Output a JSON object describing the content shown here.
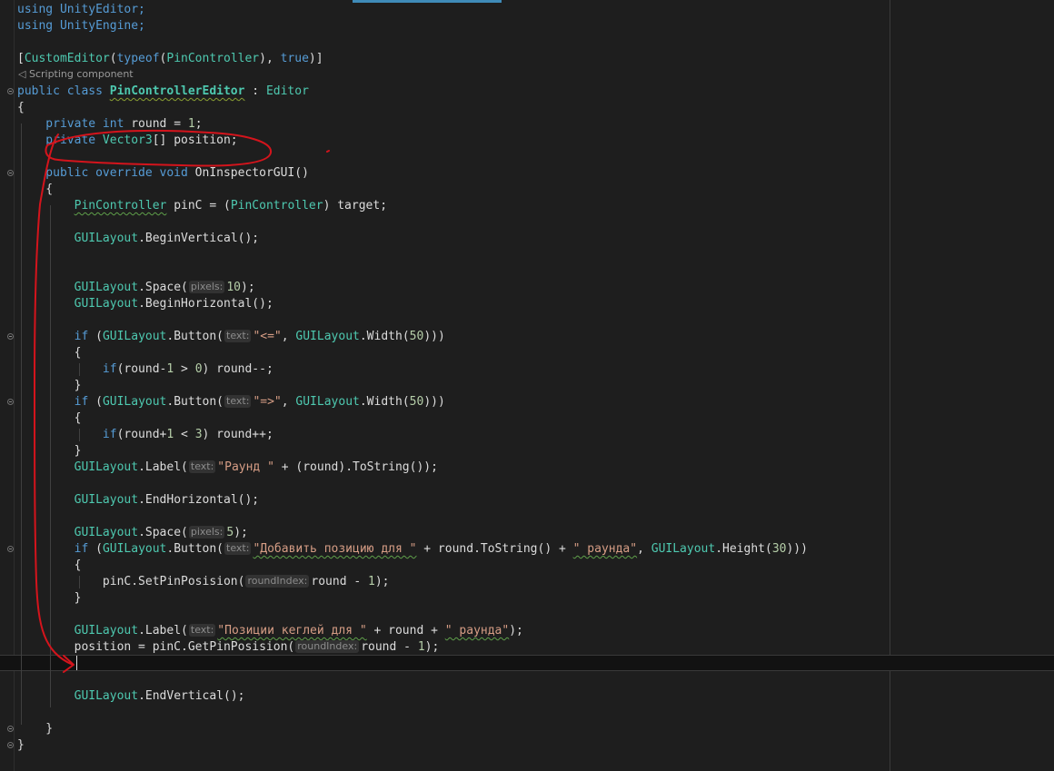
{
  "editor": {
    "codelens": "Scripting component",
    "hints": {
      "pixels": "pixels:",
      "text": "text:",
      "roundIndex": "roundIndex:"
    },
    "lines": {
      "l1": "using UnityEditor;",
      "l2": "using UnityEngine;",
      "l3a": "[",
      "l3b": "CustomEditor",
      "l3c": "(",
      "l3d": "typeof",
      "l3e": "(",
      "l3f": "PinController",
      "l3g": "), ",
      "l3h": "true",
      "l3i": ")]",
      "l4a": "public class ",
      "l4b": "PinControllerEditor",
      "l4c": " : ",
      "l4d": "Editor",
      "l5": "{",
      "l6a": "    private int ",
      "l6b": "round = ",
      "l6c": "1",
      "l6d": ";",
      "l7a": "    private ",
      "l7b": "Vector3",
      "l7c": "[] position;",
      "l8a": "    public override void ",
      "l8b": "OnInspectorGUI()",
      "l9": "    {",
      "l10a": "        ",
      "l10b": "PinController",
      "l10c": " pinC = (",
      "l10d": "PinController",
      "l10e": ") target;",
      "l11a": "        ",
      "l11b": "GUILayout",
      "l11c": ".BeginVertical();",
      "l12a": "        ",
      "l12b": "GUILayout",
      "l12c": ".Space(",
      "l12d": "10",
      "l12e": ");",
      "l13a": "        ",
      "l13b": "GUILayout",
      "l13c": ".BeginHorizontal();",
      "l14a": "        ",
      "l14b": "if",
      "l14c": " (",
      "l14d": "GUILayout",
      "l14e": ".Button(",
      "l14f": "\"<=\"",
      "l14g": ", ",
      "l14h": "GUILayout",
      "l14i": ".Width(",
      "l14j": "50",
      "l14k": ")))",
      "l15": "        {",
      "l16a": "            ",
      "l16b": "if",
      "l16c": "(round-",
      "l16d": "1",
      "l16e": " > ",
      "l16f": "0",
      "l16g": ") round--;",
      "l17": "        }",
      "l18a": "        ",
      "l18b": "if",
      "l18c": " (",
      "l18d": "GUILayout",
      "l18e": ".Button(",
      "l18f": "\"=>\"",
      "l18g": ", ",
      "l18h": "GUILayout",
      "l18i": ".Width(",
      "l18j": "50",
      "l18k": ")))",
      "l19": "        {",
      "l20a": "            ",
      "l20b": "if",
      "l20c": "(round+",
      "l20d": "1",
      "l20e": " < ",
      "l20f": "3",
      "l20g": ") round++;",
      "l21": "        }",
      "l22a": "        ",
      "l22b": "GUILayout",
      "l22c": ".Label(",
      "l22d": "\"Раунд \"",
      "l22e": " + (round).ToString());",
      "l23a": "        ",
      "l23b": "GUILayout",
      "l23c": ".EndHorizontal();",
      "l24a": "        ",
      "l24b": "GUILayout",
      "l24c": ".Space(",
      "l24d": "5",
      "l24e": ");",
      "l25a": "        ",
      "l25b": "if",
      "l25c": " (",
      "l25d": "GUILayout",
      "l25e": ".Button(",
      "l25f": "\"Добавить позицию для \"",
      "l25g": " + round.ToString() + ",
      "l25h": "\" раунда\"",
      "l25i": ", ",
      "l25j": "GUILayout",
      "l25k": ".Height(",
      "l25l": "30",
      "l25m": ")))",
      "l26": "        {",
      "l27a": "            pinC.SetPinPosision(",
      "l27b": "round - ",
      "l27c": "1",
      "l27d": ");",
      "l28": "        }",
      "l29a": "        ",
      "l29b": "GUILayout",
      "l29c": ".Label(",
      "l29d": "\"Позиции кеглей для \"",
      "l29e": " + round + ",
      "l29f": "\" раунда\"",
      "l29g": ");",
      "l30a": "        position = pinC.GetPinPosision(",
      "l30b": "round - ",
      "l30c": "1",
      "l30d": ");",
      "l31a": "        ",
      "l31b": "GUILayout",
      "l31c": ".EndVertical();",
      "l32": "    }",
      "l33": "}"
    },
    "colors": {
      "background": "#1e1e1e",
      "keyword": "#569cd6",
      "type": "#4ec9b0",
      "string": "#d69d85",
      "number": "#b5cea8",
      "annotation": "#d4141c"
    }
  }
}
